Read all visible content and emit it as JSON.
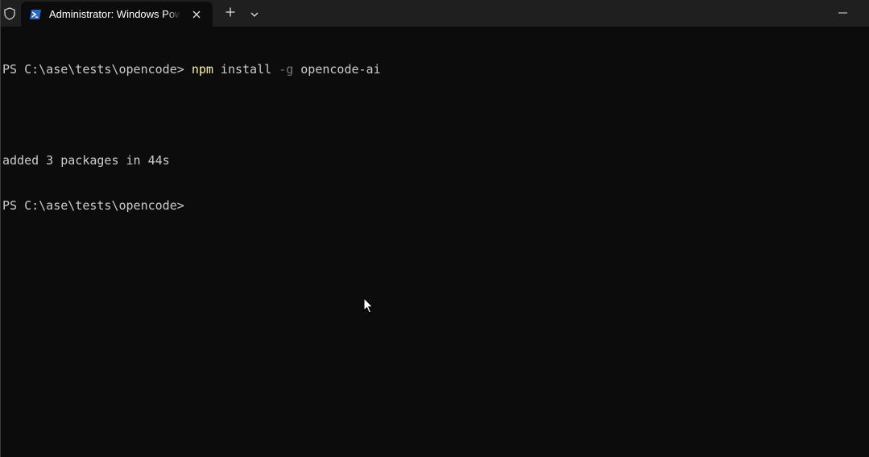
{
  "window": {
    "tab_title": "Administrator: Windows PowerShell",
    "icons": {
      "shield": "shield-icon",
      "powershell": "powershell-icon",
      "close": "close-icon",
      "new_tab": "plus-icon",
      "dropdown": "chevron-down-icon",
      "minimize": "minimize-icon",
      "pointer": "mouse-pointer-icon"
    }
  },
  "terminal": {
    "line1": {
      "prompt": "PS C:\\ase\\tests\\opencode> ",
      "command": "npm",
      "arg1": " install ",
      "flag": "-g",
      "arg2": " opencode-ai"
    },
    "line2": "",
    "line3": "added 3 packages in 44s",
    "line4": {
      "prompt": "PS C:\\ase\\tests\\opencode>"
    }
  },
  "colors": {
    "background": "#0c0c0c",
    "titlebar": "#1f1f1f",
    "foreground": "#cccccc",
    "command": "#f9f1a5",
    "parameter": "#767676",
    "powershell_blue": "#2a66c8"
  }
}
